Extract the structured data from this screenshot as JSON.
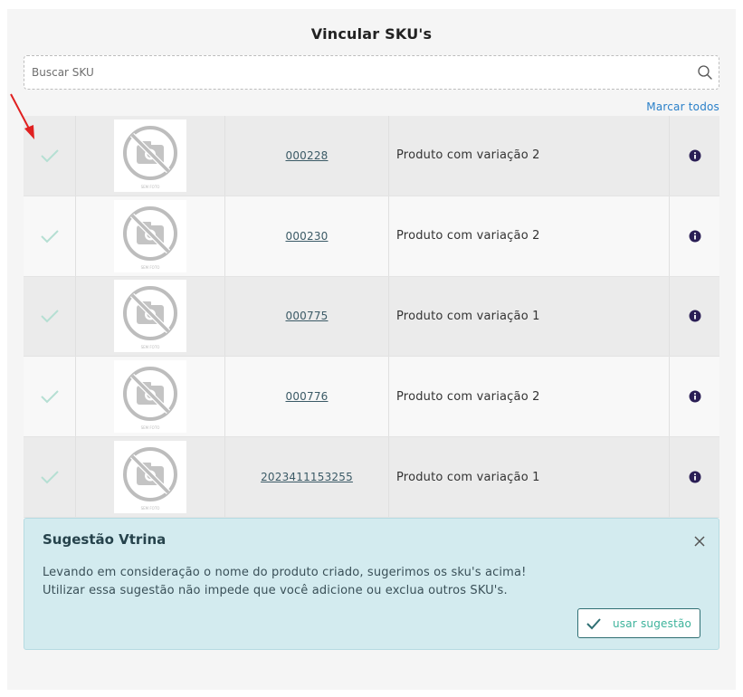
{
  "header": {
    "title": "Vincular SKU's"
  },
  "search": {
    "placeholder": "Buscar SKU",
    "value": ""
  },
  "actions": {
    "mark_all": "Marcar todos"
  },
  "colors": {
    "accent_link": "#2a80c9",
    "check": "#b5dfd3",
    "info_icon": "#2a1e55",
    "suggest_bg": "#d3ebef",
    "button_text": "#3db39b"
  },
  "skus": [
    {
      "code": "000228",
      "name": "Produto com variação 2",
      "image_text": "SEM FOTO"
    },
    {
      "code": "000230",
      "name": "Produto com variação 2",
      "image_text": "SEM FOTO"
    },
    {
      "code": "000775",
      "name": "Produto com variação 1",
      "image_text": "SEM FOTO"
    },
    {
      "code": "000776",
      "name": "Produto com variação 2",
      "image_text": "SEM FOTO"
    },
    {
      "code": "2023411153255",
      "name": "Produto com variação 1",
      "image_text": "SEM FOTO"
    }
  ],
  "suggestion": {
    "title": "Sugestão Vtrina",
    "line1": "Levando em consideração o nome do produto criado, sugerimos os sku's acima!",
    "line2": "Utilizar essa sugestão não impede que você adicione ou exclua outros SKU's.",
    "button_label": "usar sugestão"
  },
  "icons": {
    "search": "search-icon",
    "check": "check-icon",
    "info": "info-icon",
    "close": "close-icon",
    "no_photo": "no-photo-icon",
    "arrow": "red-arrow-annotation"
  }
}
